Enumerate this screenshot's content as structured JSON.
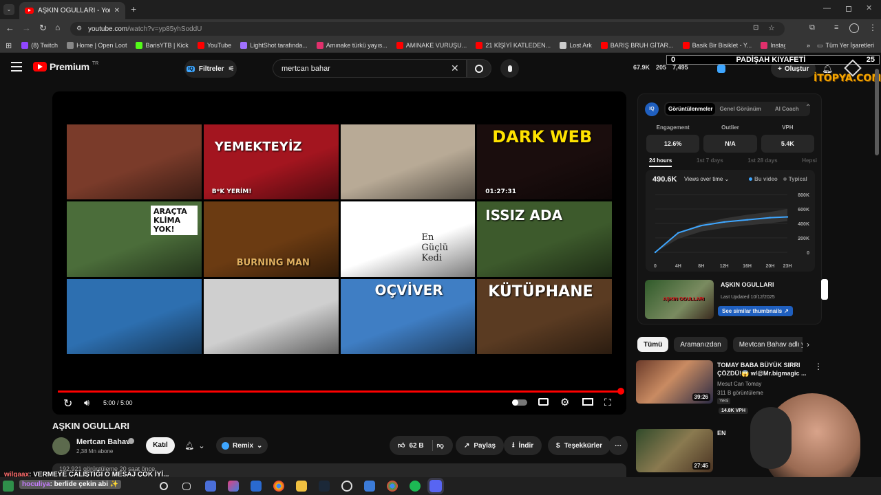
{
  "browser": {
    "tab_title": "AŞKIN OGULLARI - YouTube",
    "url_domain": "youtube.com",
    "url_path": "/watch?v=yp85yhSoddU",
    "bookmarks": [
      {
        "label": "(8) Twitch",
        "color": "#9146ff"
      },
      {
        "label": "Home | Open Loot",
        "color": "#888888"
      },
      {
        "label": "BarisYTB | Kick",
        "color": "#53fc18"
      },
      {
        "label": "YouTube",
        "color": "#ff0000"
      },
      {
        "label": "LightShot tarafında...",
        "color": "#a070ff"
      },
      {
        "label": "Amınake türkü yayıs...",
        "color": "#e1306c"
      },
      {
        "label": "AMINAKE VURUŞU...",
        "color": "#ff0000"
      },
      {
        "label": "21 KİŞİYİ KATLEDEN...",
        "color": "#ff0000"
      },
      {
        "label": "Lost Ark",
        "color": "#cccccc"
      },
      {
        "label": "BARIŞ BRUH GİTAR...",
        "color": "#ff0000"
      },
      {
        "label": "Basik Bir Bisiklet - Y...",
        "color": "#ff0000"
      },
      {
        "label": "Instagram videosu:...",
        "color": "#e1306c"
      }
    ],
    "bookmarks_overflow": "»",
    "all_bookmarks": "Tüm Yer İşaretleri"
  },
  "header": {
    "logo_text": "Premium",
    "logo_sup": "TR",
    "filters_label": "Filtreler",
    "search_value": "mertcan bahar",
    "stat1": "67.9K",
    "stat2": "205",
    "stat3": "7,495",
    "create_label": "Oluştur"
  },
  "overlay": {
    "left_num": "0",
    "title": "PADİŞAH KIYAFETİ",
    "right_num": "25",
    "brand": "İTOPYA.COM"
  },
  "player": {
    "time": "5:00 / 5:00",
    "progress": 1.0,
    "thumbs": [
      {
        "text": "",
        "bg": "#7a3b2a"
      },
      {
        "text": "YEMEKTEYİZ",
        "sub": "B*K YERİM!",
        "bg": "#a3151f"
      },
      {
        "text": "",
        "bg": "#b8aa96"
      },
      {
        "text": "DARK WEB",
        "sub": "01:27:31",
        "bg": "#1a0d0d"
      },
      {
        "text": "ARAÇTA KLİMA YOK!",
        "bg": "#4b6d3a"
      },
      {
        "text": "BURNING MAN",
        "bg": "#6b3b12"
      },
      {
        "text": "En Güçlü Kedi",
        "bg": "#ffffff"
      },
      {
        "text": "ISSIZ ADA",
        "bg": "#3d5a2c"
      },
      {
        "text": "",
        "bg": "#2d6fb0"
      },
      {
        "text": "",
        "bg": "#cfcfcf"
      },
      {
        "text": "OÇVİVER",
        "bg": "#3f7ec4"
      },
      {
        "text": "KÜTÜPHANE",
        "bg": "#5a3b22"
      }
    ]
  },
  "video": {
    "title": "AŞKIN OGULLARI",
    "channel": "Mertcan Bahav",
    "subs": "2,38 Mn abone",
    "join": "Katıl",
    "remix": "Remix",
    "likes": "62 B",
    "share": "Paylaş",
    "download": "İndir",
    "thanks": "Teşekkürler",
    "desc_partial": "192.921 görüntüleme  20 saat önce"
  },
  "iq": {
    "tabs": [
      "Görüntülenmeler",
      "Genel Görünüm",
      "AI Coach"
    ],
    "metrics": [
      {
        "label": "Engagement",
        "value": "12.6%"
      },
      {
        "label": "Outlier",
        "value": "N/A"
      },
      {
        "label": "VPH",
        "value": "5.4K"
      }
    ],
    "ranges": [
      "24 hours",
      "1st 7 days",
      "1st 28 days",
      "Hepsi"
    ],
    "total": "490.6K",
    "mode": "Views over time",
    "legend_video": "Bu video",
    "legend_typical": "Typical",
    "yticks": [
      "800K",
      "600K",
      "400K",
      "200K",
      "0"
    ],
    "xticks": [
      "0",
      "4H",
      "8H",
      "12H",
      "16H",
      "20H",
      "23H"
    ],
    "card_title": "AŞKIN OGULLARI",
    "card_updated": "Last Updated 10/12/2025",
    "card_button": "See similar thumbnails"
  },
  "chart_data": {
    "type": "line",
    "x": [
      0,
      4,
      8,
      12,
      16,
      20,
      23
    ],
    "series": [
      {
        "name": "Bu video",
        "values": [
          0,
          270000,
          370000,
          420000,
          450000,
          480000,
          490000
        ]
      },
      {
        "name": "Typical",
        "values": [
          0,
          260000,
          400000,
          470000,
          520000,
          560000,
          600000
        ]
      }
    ],
    "xlabel": "",
    "ylabel": "",
    "ylim": [
      0,
      800000
    ]
  },
  "chips": [
    "Tümü",
    "Aramanızdan",
    "Mevtcan Bahav adlı yükl"
  ],
  "related": [
    {
      "title": "TOMAY BABA BÜYÜK SIRRI ÇÖZDÜ!😱 w/@Mr.bigmagic ...",
      "channel": "Mesut Can Tomay",
      "views": "311 B görüntüleme",
      "badge": "Yeni",
      "vph": "14.8K VPH",
      "duration": "39:26"
    },
    {
      "title": "EN",
      "channel": "",
      "views": "",
      "badge": "",
      "vph": "",
      "duration": "27:45"
    }
  ],
  "chat": [
    {
      "user": "wilgaax",
      "text": ": VERMEYE ÇALIŞTIĞI O MESAJ ÇOK İYİ...",
      "color": "#ff6b6b"
    },
    {
      "user": "hoculiya",
      "text": ": berlide çekin abi",
      "color": "#c77dff"
    }
  ]
}
